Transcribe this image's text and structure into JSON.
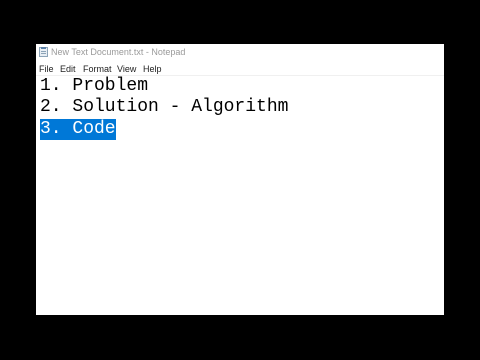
{
  "window": {
    "title": "New Text Document.txt - Notepad"
  },
  "menu": {
    "items": [
      "File",
      "Edit",
      "Format",
      "View",
      "Help"
    ]
  },
  "editor": {
    "lines": [
      "1. Problem",
      "2. Solution - Algorithm",
      "3. Code"
    ],
    "selected_line": 3
  },
  "colors": {
    "selection_background": "#0078d7",
    "selection_text": "#ffffff",
    "frame_background": "#000000"
  },
  "icons": {
    "app_icon": "notepad-icon"
  }
}
